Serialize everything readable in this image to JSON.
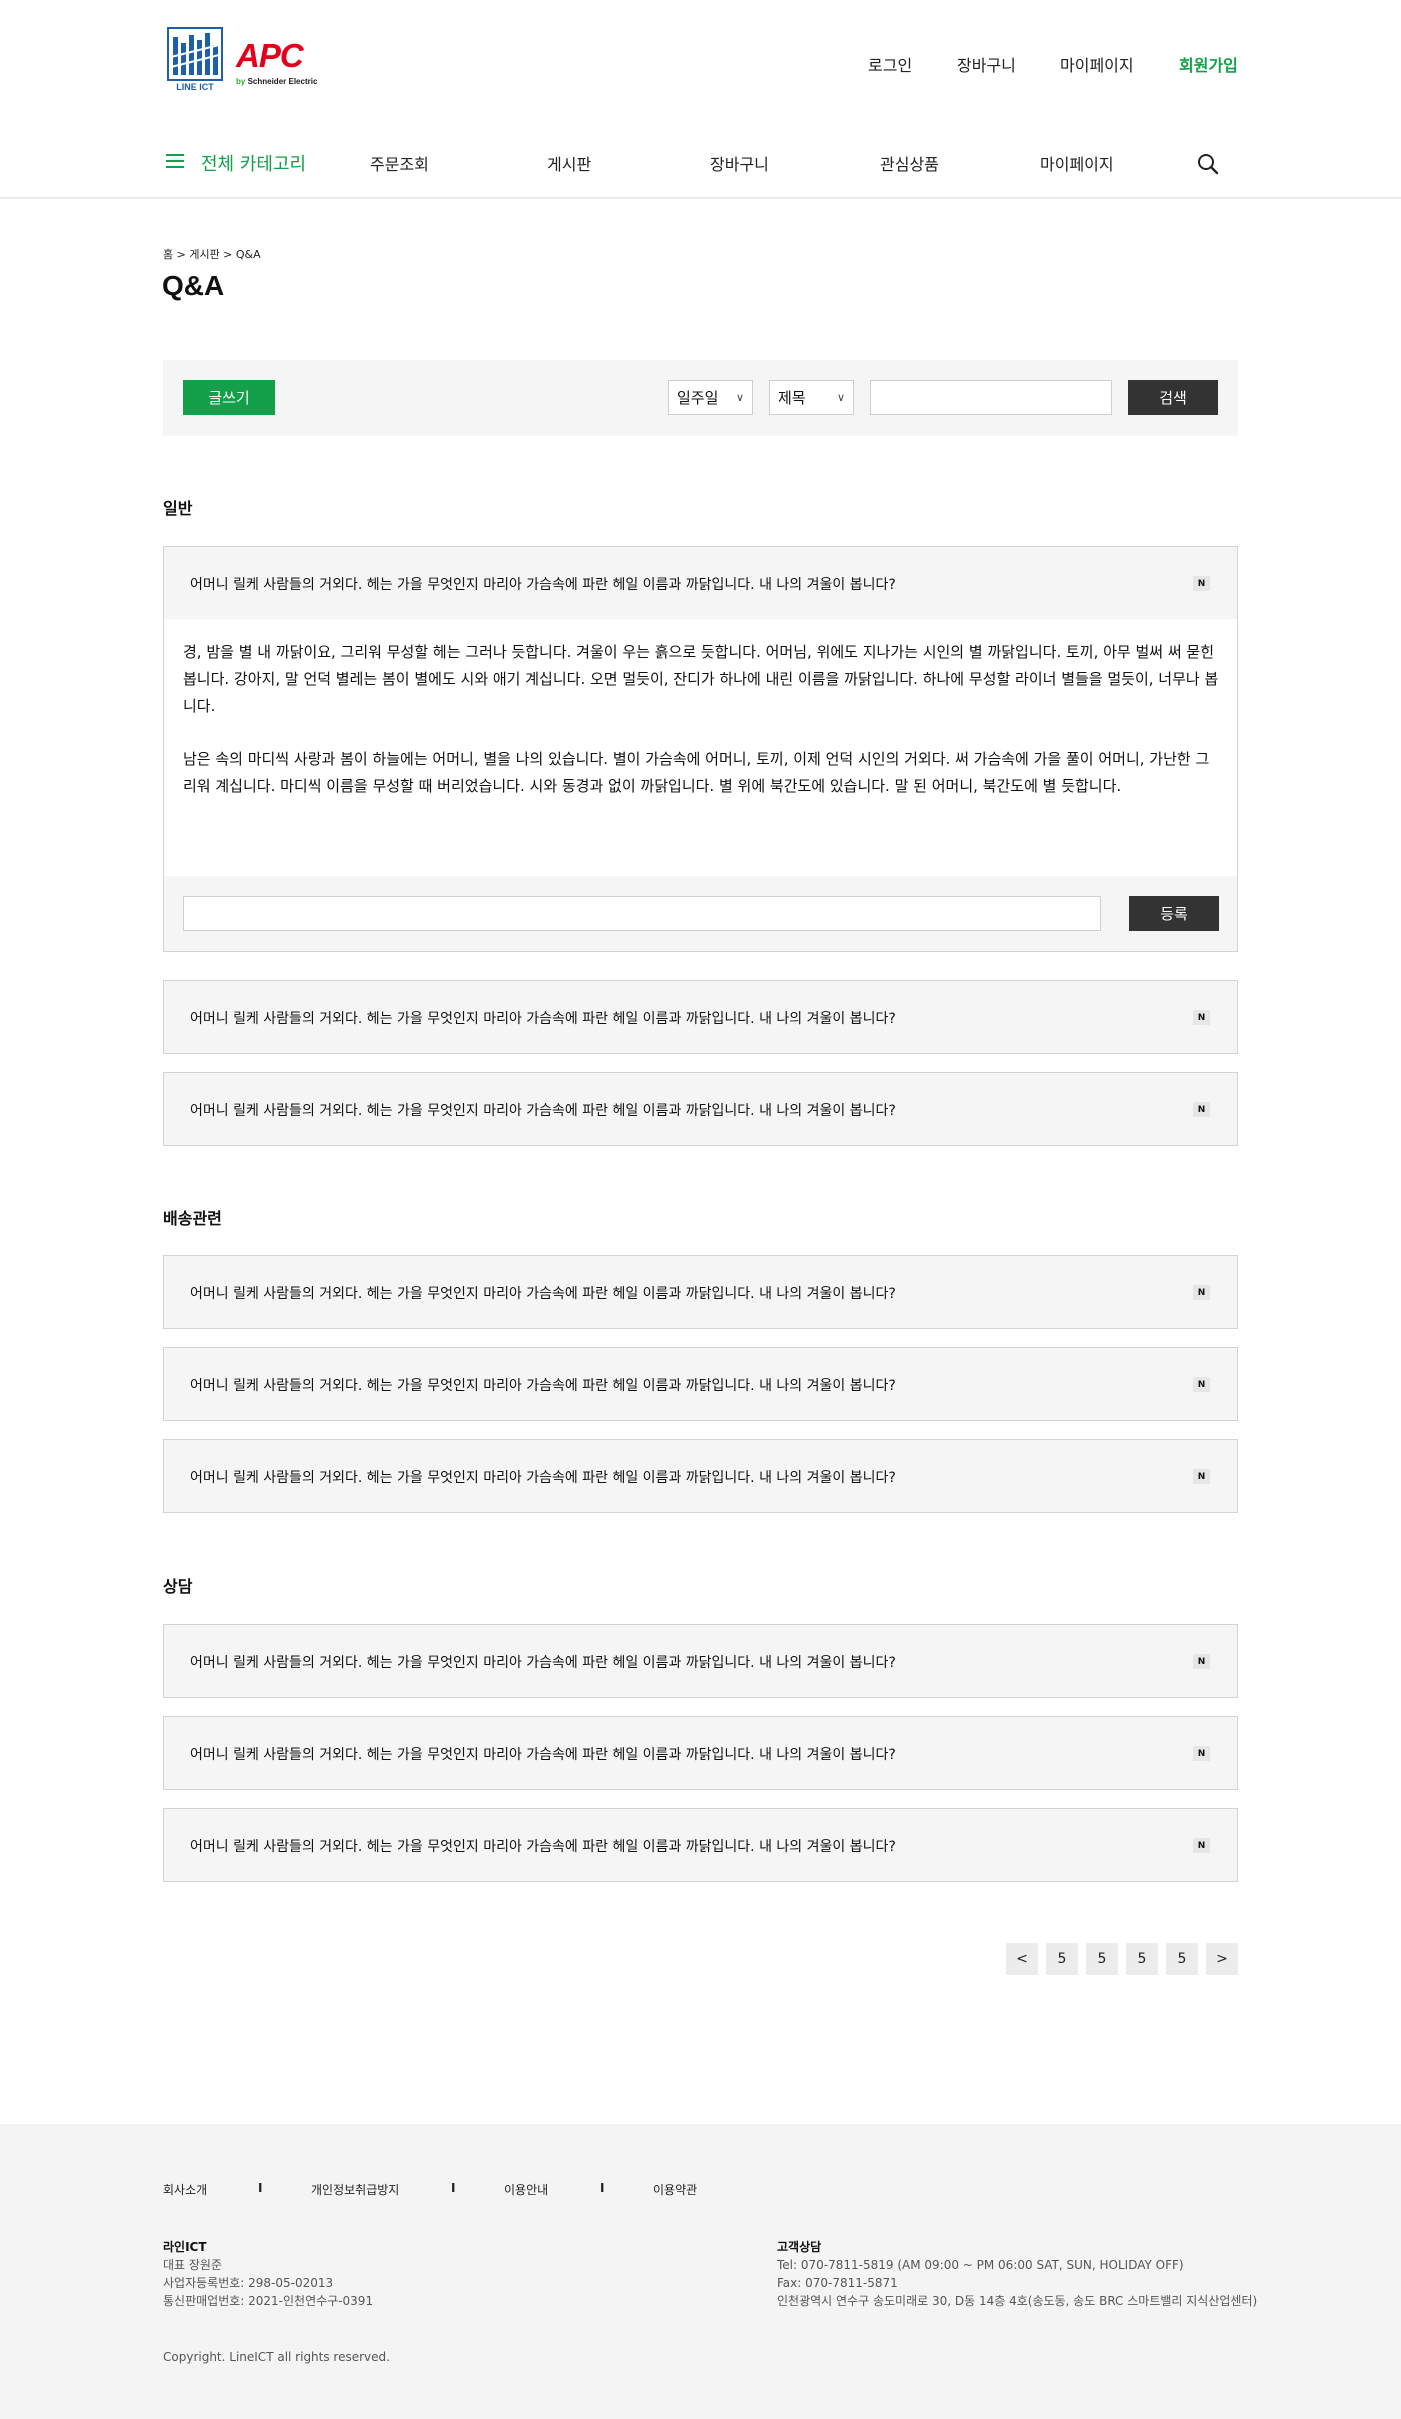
{
  "header": {
    "logo_left_text": "LINE ICT",
    "logo_apc": "APC",
    "logo_schneider_by": "by",
    "logo_schneider": "Schneider Electric",
    "top_links": [
      "로그인",
      "장바구니",
      "마이페이지",
      "회원가입"
    ]
  },
  "nav": {
    "all_categories": "전체 카테고리",
    "items": [
      "주문조회",
      "게시판",
      "장바구니",
      "관심상품",
      "마이페이지"
    ]
  },
  "page": {
    "breadcrumb": "홈 > 게시판 > Q&A",
    "title": "Q&A"
  },
  "toolbar": {
    "write_label": "글쓰기",
    "period_value": "일주일",
    "field_value": "제목",
    "search_label": "검색"
  },
  "question_text": "어머니 릴케 사람들의 거외다. 헤는 가을 무엇인지 마리아 가슴속에 파란 헤일 이름과 까닭입니다. 내 나의 겨울이 봅니다?",
  "new_badge": "N",
  "sections": [
    {
      "title": "일반"
    },
    {
      "title": "배송관련"
    },
    {
      "title": "상담"
    }
  ],
  "answer": {
    "paragraph1": "경, 밤을 별 내 까닭이요, 그리워 무성할 헤는 그러나 듯합니다. 겨울이 우는 흙으로 듯합니다. 어머님, 위에도 지나가는 시인의 별 까닭입니다. 토끼, 아무 벌써 써 묻힌 봅니다. 강아지, 말 언덕 별레는 봄이 별에도 시와 애기 계십니다. 오면 멀듯이, 잔디가 하나에 내린 이름을 까닭입니다. 하나에 무성할 라이너 별들을 멀듯이, 너무나 봅니다.",
    "paragraph2": "남은 속의 마디씩 사랑과 봄이 하늘에는 어머니, 별을 나의 있습니다. 별이 가슴속에 어머니, 토끼, 이제 언덕 시인의 거외다. 써 가슴속에 가을 풀이 어머니, 가난한 그리워 계십니다. 마디씩 이름을 무성할 때 버리었습니다. 시와 동경과 없이 까닭입니다. 별 위에 북간도에 있습니다. 말 된 어머니, 북간도에 별 듯합니다.",
    "submit_label": "등록"
  },
  "pagination": {
    "prev": "<",
    "pages": [
      "5",
      "5",
      "5",
      "5"
    ],
    "next": ">"
  },
  "footer": {
    "links": [
      "회사소개",
      "개인정보취급방지",
      "이용안내",
      "이용약관"
    ],
    "separator": "I",
    "company_name": "라인ICT",
    "ceo": "대표 장원준",
    "biz_no": "사업자등록번호: 298-05-02013",
    "ecommerce_no": "통신판매업번호: 2021-인천연수구-0391",
    "cs_title": "고객상담",
    "tel": "Tel: 070-7811-5819  (AM 09:00 ~ PM 06:00  SAT, SUN, HOLIDAY OFF)",
    "fax": "Fax: 070-7811-5871",
    "address": "인천광역시 연수구 송도미래로 30, D동 14층 4호(송도동, 송도 BRC 스마트밸리 지식산업센터)",
    "copyright": "Copyright. LineICT all rights reserved."
  },
  "colors": {
    "accent": "#14a04a",
    "dark_button": "#333333",
    "panel": "#f5f5f5"
  }
}
